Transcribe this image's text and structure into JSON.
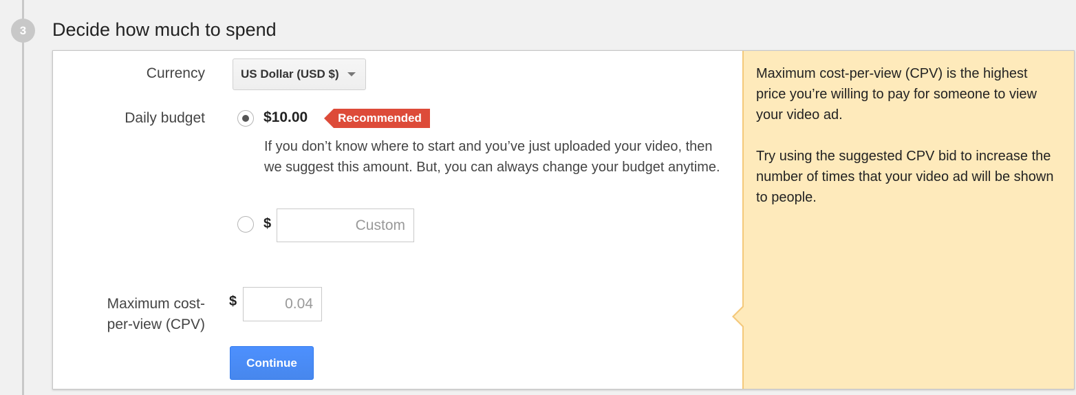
{
  "step": {
    "number": "3",
    "title": "Decide how much to spend"
  },
  "form": {
    "currency_label": "Currency",
    "currency_value": "US Dollar (USD $)",
    "daily_budget_label": "Daily budget",
    "recommended_amount": "$10.00",
    "recommended_badge": "Recommended",
    "recommended_help": "If you don’t know where to start and you’ve just uploaded your video, then we suggest this amount. But, you can always change your budget anytime.",
    "custom_currency_symbol": "$",
    "custom_placeholder": "Custom",
    "cpv_label": "Maximum cost-per-view (CPV)",
    "cpv_currency_symbol": "$",
    "cpv_placeholder": "0.04",
    "continue_label": "Continue"
  },
  "sidebar_note": {
    "paragraph_1": "Maximum cost-per-view (CPV) is the highest price you’re willing to pay for someone to view your video ad.",
    "paragraph_2": "Try using the suggested CPV bid to increase the number of times that your video ad will be shown to people."
  },
  "colors": {
    "badge_red": "#dd4b39",
    "primary_blue": "#4d90fe",
    "note_background": "#feeabb"
  }
}
